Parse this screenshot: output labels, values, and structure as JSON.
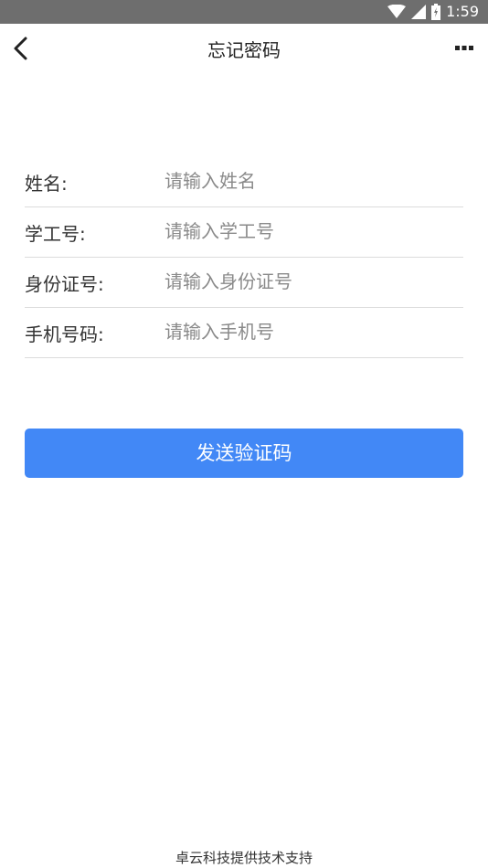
{
  "status_bar": {
    "time": "1:59",
    "icons": [
      "wifi-icon",
      "cell-signal-icon",
      "battery-charging-icon"
    ]
  },
  "header": {
    "title": "忘记密码",
    "back_icon": "chevron-left-icon",
    "more_icon": "more-dots-icon"
  },
  "form": {
    "fields": [
      {
        "label": "姓名:",
        "placeholder": "请输入姓名",
        "value": ""
      },
      {
        "label": "学工号:",
        "placeholder": "请输入学工号",
        "value": ""
      },
      {
        "label": "身份证号:",
        "placeholder": "请输入身份证号",
        "value": ""
      },
      {
        "label": "手机号码:",
        "placeholder": "请输入手机号",
        "value": ""
      }
    ]
  },
  "send_button": {
    "label": "发送验证码",
    "color": "#4288f6"
  },
  "footer": {
    "text": "卓云科技提供技术支持"
  }
}
